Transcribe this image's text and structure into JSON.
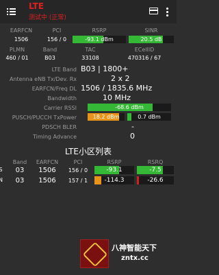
{
  "appbar": {
    "title": "LTE",
    "subtitle": "测试中 (正常)",
    "menu_icon": "menu-icon",
    "card_icon": "card-icon",
    "more_icon": "more-vert-icon"
  },
  "summary": {
    "headers1": [
      "EARFCN",
      "PCI",
      "RSRP",
      "SINR"
    ],
    "earfcn": "1506",
    "pci": "156 / 0",
    "rsrp": "-93.1 dBm",
    "rsrp_fraction": 0.58,
    "sinr": "20.5 dB",
    "sinr_fraction": 0.75,
    "headers2": [
      "PLMN",
      "Band",
      "TAC",
      "ECellID"
    ],
    "plmn": "460 / 01",
    "band": "B03",
    "tac": "33108",
    "ecellid": "470316 / 67",
    "colors": {
      "green": "#35b835",
      "dark": "#1a1a1a"
    }
  },
  "details": {
    "labels": [
      "LTE Band",
      "Antenna eNB Tx/Dev. Rx",
      "EARFCN/Freq DL",
      "Bandwidth",
      "Carrier RSSI",
      "PUSCH/PUCCH TxPower",
      "PDSCH BLER",
      "Timing Advance"
    ],
    "lte_band": "B03 | 1800+",
    "antenna": "2 x 2",
    "earfcn_freq": "1506 / 1835.6 MHz",
    "bandwidth": "10 MHz",
    "rssi": "-68.6 dBm",
    "rssi_fraction": 0.78,
    "pusch": "18.2 dBm",
    "pusch_fraction": 0.85,
    "pucch": "0.7 dBm",
    "pucch_fraction": 0.1,
    "bler": "-",
    "timing_advance": "0",
    "colors": {
      "orange": "#e8941a",
      "green": "#35b835"
    }
  },
  "neighbors": {
    "title": "LTE小区列表",
    "headers": [
      "Band",
      "EARFCN",
      "PCI",
      "RSRP",
      "RSRQ"
    ],
    "rows": [
      {
        "tag": "S",
        "band": "03",
        "earfcn": "1506",
        "pci": "156 / 0",
        "rsrp": "-93.1",
        "rsrp_fraction": 0.62,
        "rsrp_color": "#35b835",
        "rsrq": "-7.5",
        "rsrq_fraction": 0.7,
        "rsrq_color": "#35b835"
      },
      {
        "tag": "N",
        "band": "03",
        "earfcn": "1506",
        "pci": "157 / 1",
        "rsrp": "-114.3",
        "rsrp_fraction": 0.18,
        "rsrp_color": "#e8941a",
        "rsrq": "-26.6",
        "rsrq_fraction": 0.06,
        "rsrq_color": "#d02020"
      }
    ]
  },
  "watermark": {
    "text": "八神智能天下",
    "url": "zntx.cc"
  }
}
